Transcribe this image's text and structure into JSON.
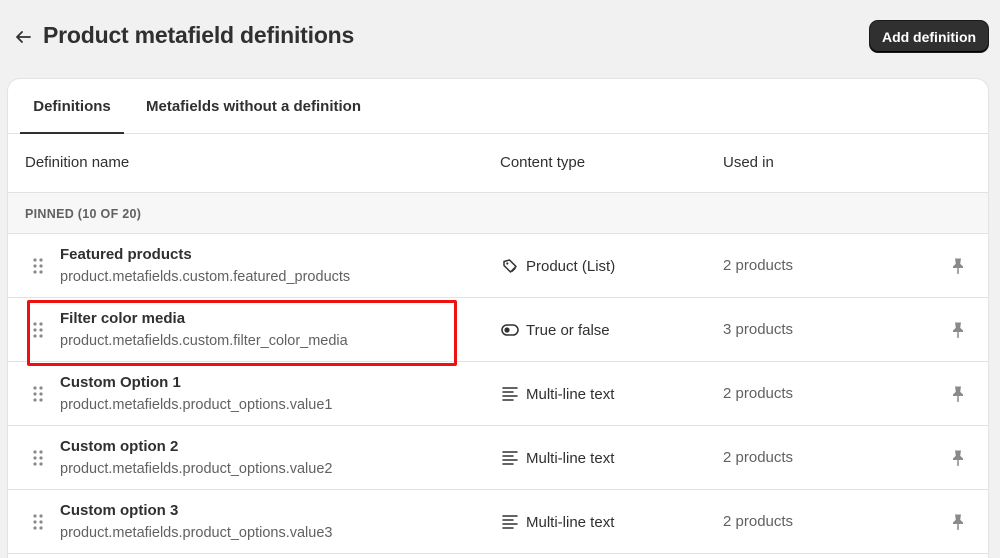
{
  "header": {
    "title": "Product metafield definitions",
    "add_button_label": "Add definition"
  },
  "tabs": [
    {
      "label": "Definitions",
      "active": true
    },
    {
      "label": "Metafields without a definition",
      "active": false
    }
  ],
  "columns": {
    "name": "Definition name",
    "content_type": "Content type",
    "used_in": "Used in"
  },
  "section": {
    "label": "PINNED (10 OF 20)"
  },
  "rows": [
    {
      "name": "Featured products",
      "key": "product.metafields.custom.featured_products",
      "content_type": "Product (List)",
      "icon": "product-tag-icon",
      "used_in": "2 products"
    },
    {
      "name": "Filter color media",
      "key": "product.metafields.custom.filter_color_media",
      "content_type": "True or false",
      "icon": "toggle-icon",
      "used_in": "3 products"
    },
    {
      "name": "Custom Option 1",
      "key": "product.metafields.product_options.value1",
      "content_type": "Multi-line text",
      "icon": "text-lines-icon",
      "used_in": "2 products"
    },
    {
      "name": "Custom option 2",
      "key": "product.metafields.product_options.value2",
      "content_type": "Multi-line text",
      "icon": "text-lines-icon",
      "used_in": "2 products"
    },
    {
      "name": "Custom option 3",
      "key": "product.metafields.product_options.value3",
      "content_type": "Multi-line text",
      "icon": "text-lines-icon",
      "used_in": "2 products"
    }
  ],
  "colors": {
    "highlight": "#ee1111",
    "primary_button": "#303030"
  }
}
